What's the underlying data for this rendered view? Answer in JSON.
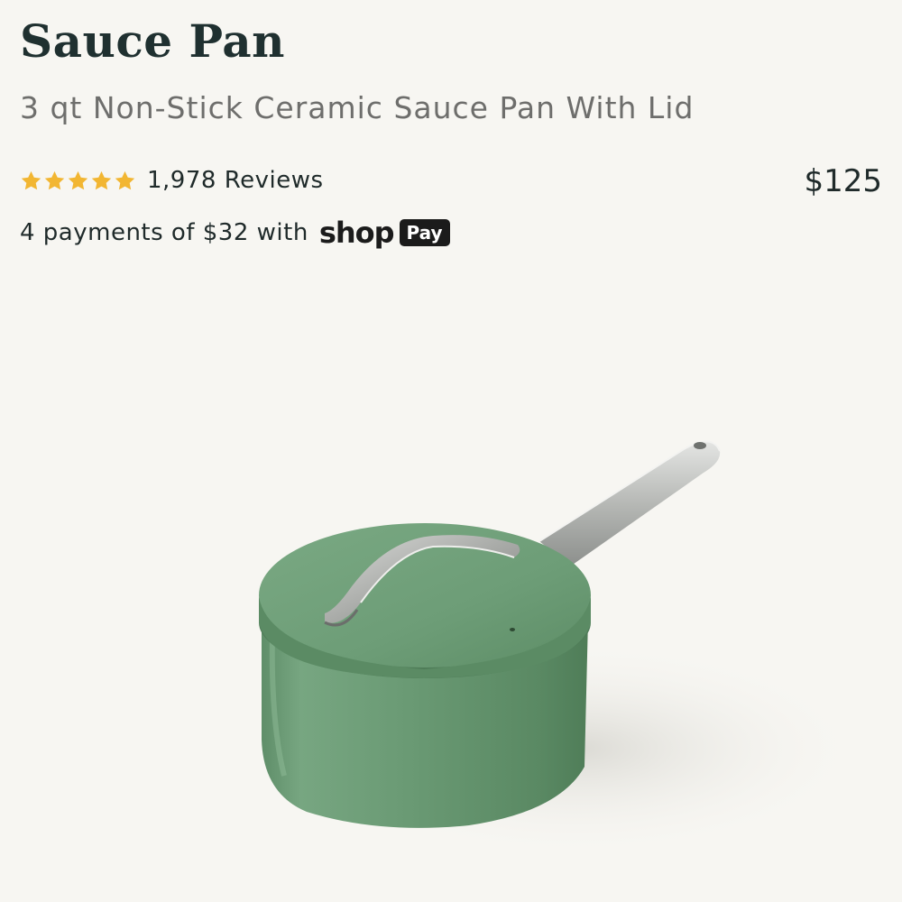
{
  "product": {
    "title": "Sauce Pan",
    "subtitle": "3 qt Non-Stick Ceramic Sauce Pan With Lid",
    "price": "$125",
    "rating": {
      "stars": 5,
      "reviews_label": "1,978 Reviews"
    },
    "installments": {
      "text": "4 payments of $32 with",
      "shop_label": "shop",
      "pay_label": "Pay"
    },
    "image": {
      "subject": "green sauce pan with lid",
      "body_color": "#6a9a74",
      "star_color": "#f2b632"
    }
  }
}
